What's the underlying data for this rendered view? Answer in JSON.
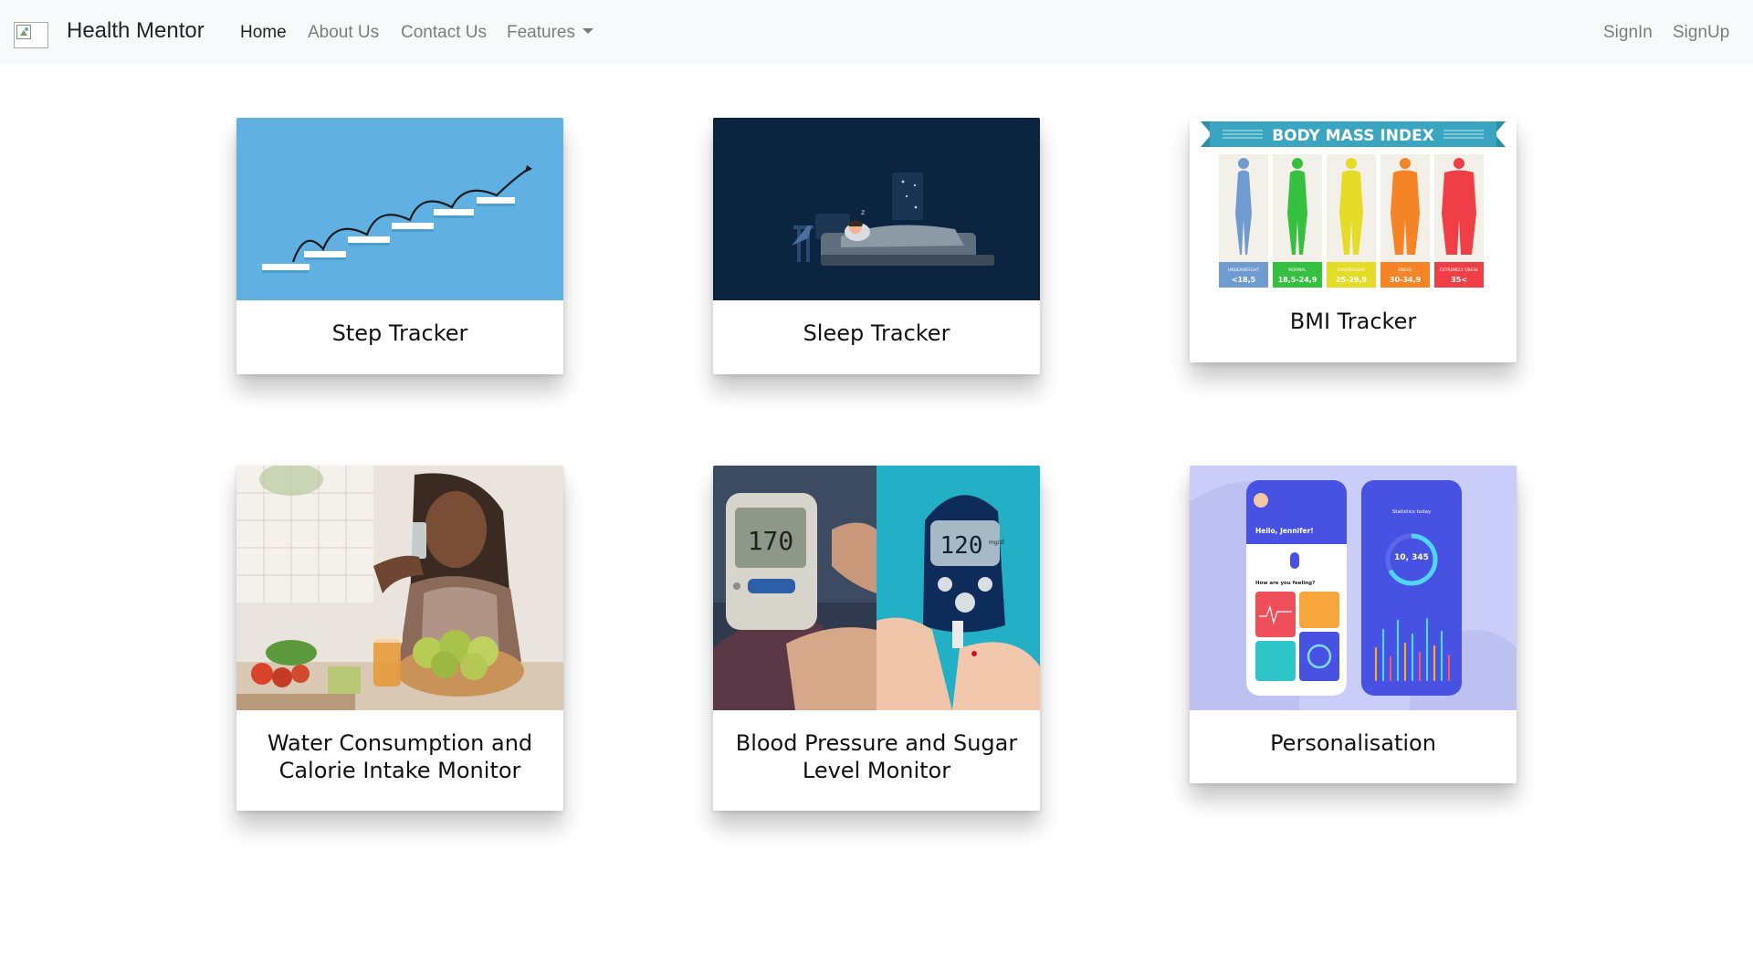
{
  "navbar": {
    "brand": "Health Mentor",
    "links": [
      {
        "label": "Home",
        "active": true
      },
      {
        "label": "About Us",
        "active": false
      },
      {
        "label": "Contact Us",
        "active": false
      },
      {
        "label": "Features",
        "active": false
      }
    ],
    "auth": [
      {
        "label": "SignIn"
      },
      {
        "label": "SignUp"
      }
    ]
  },
  "cards": [
    {
      "title": "Step Tracker",
      "image": "step-tracker-image"
    },
    {
      "title": "Sleep Tracker",
      "image": "sleep-tracker-image"
    },
    {
      "title": "BMI Tracker",
      "image": "bmi-chart-image"
    },
    {
      "title": "Water Consumption and Calorie Intake Monitor",
      "image": "water-calorie-image"
    },
    {
      "title": "Blood Pressure and Sugar Level Monitor",
      "image": "blood-pressure-sugar-image"
    },
    {
      "title": "Personalisation",
      "image": "personalisation-app-image"
    }
  ],
  "bmi_image": {
    "banner": "BODY MASS INDEX",
    "categories": [
      {
        "label": "UNDERWEIGHT",
        "range": "<18,5",
        "color": "#6f9bd1"
      },
      {
        "label": "NORMAL",
        "range": "18,5-24,9",
        "color": "#35c040"
      },
      {
        "label": "OVERWEIGHT",
        "range": "25-29,9",
        "color": "#e5dc28"
      },
      {
        "label": "OBESE",
        "range": "30-34,9",
        "color": "#f58426"
      },
      {
        "label": "EXTREMELY OBESE",
        "range": "35<",
        "color": "#ef3e45"
      }
    ]
  },
  "bp_image": {
    "monitor_reading": "170",
    "glucose_reading": "120",
    "glucose_unit": "mg/dl"
  },
  "app_image": {
    "greeting": "Hello, Jennifer!",
    "question": "How are you feeling?",
    "stats_title": "Statistics today",
    "steps_value": "10, 345"
  },
  "colors": {
    "navbar_bg": "#f8f9fa",
    "nav_active": "#212529",
    "nav_muted": "#7a7d80",
    "step_bg": "#5aaee0",
    "sleep_bg": "#0b2440",
    "person_bg": "#c9cdf7"
  }
}
